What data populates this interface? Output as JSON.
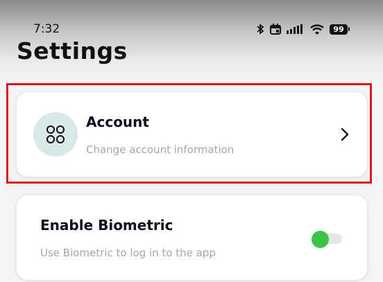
{
  "status_bar": {
    "time": "7:32",
    "battery": "99",
    "icons": [
      "bluetooth-icon",
      "calendar-icon",
      "signal-icon",
      "wifi-icon",
      "battery-icon"
    ]
  },
  "page": {
    "title": "Settings"
  },
  "cards": {
    "account": {
      "title": "Account",
      "subtitle": "Change account information",
      "icon": "grid-icon",
      "action_icon": "chevron-right-icon"
    },
    "biometric": {
      "title": "Enable Biometric",
      "subtitle": "Use Biometric to log in to the app",
      "toggle_color": "#3ac44a",
      "toggle_state": "on"
    }
  },
  "colors": {
    "highlight": "#e1161c",
    "avatar_bg": "#d9e8e8",
    "subtitle": "#a4a5b5",
    "title": "#0d0d1f"
  }
}
